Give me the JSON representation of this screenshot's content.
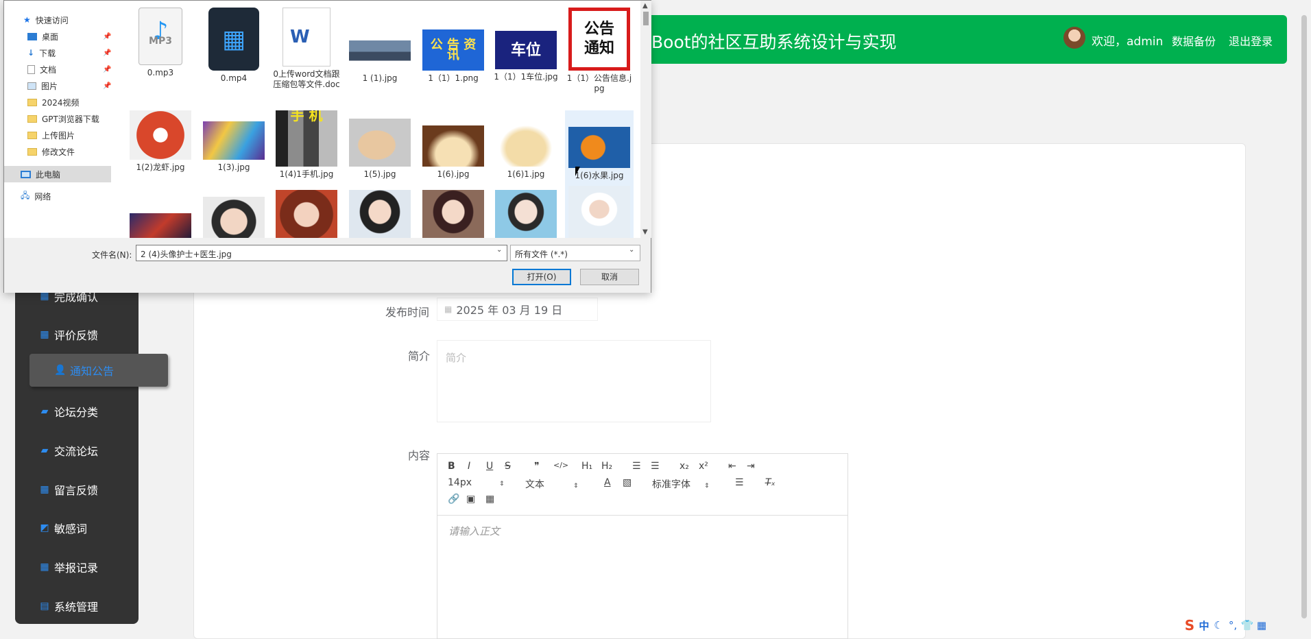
{
  "header": {
    "title": "Boot的社区互助系统设计与实现",
    "welcome": "欢迎，admin",
    "backup_label": "数据备份",
    "logout_label": "退出登录"
  },
  "sidebar": {
    "items": [
      {
        "label": "完成确认",
        "icon": "grid-icon"
      },
      {
        "label": "评价反馈",
        "icon": "grid-icon"
      },
      {
        "label": "通知公告",
        "icon": "user-icon",
        "active": true
      },
      {
        "label": "论坛分类",
        "icon": "chat-icon"
      },
      {
        "label": "交流论坛",
        "icon": "chat-icon"
      },
      {
        "label": "留言反馈",
        "icon": "grid-icon"
      },
      {
        "label": "敏感词",
        "icon": "chart-icon"
      },
      {
        "label": "举报记录",
        "icon": "grid-icon"
      },
      {
        "label": "系统管理",
        "icon": "clipboard-icon"
      }
    ]
  },
  "form": {
    "date_label": "发布时间",
    "date_value": "2025 年 03 月 19 日",
    "intro_label": "简介",
    "intro_placeholder": "简介",
    "content_label": "内容",
    "editor_placeholder": "请输入正文",
    "toolbar": {
      "font_size": "14px",
      "text_style": "文本",
      "font_family": "标准字体"
    }
  },
  "dialog": {
    "nav": [
      {
        "label": "快速访问",
        "icon": "star-icon"
      },
      {
        "label": "桌面",
        "icon": "desktop-icon",
        "pinned": true
      },
      {
        "label": "下载",
        "icon": "download-icon",
        "pinned": true
      },
      {
        "label": "文档",
        "icon": "document-icon",
        "pinned": true
      },
      {
        "label": "图片",
        "icon": "picture-icon",
        "pinned": true
      },
      {
        "label": "2024视频",
        "icon": "folder-icon"
      },
      {
        "label": "GPT浏览器下载",
        "icon": "folder-icon"
      },
      {
        "label": "上传图片",
        "icon": "folder-icon"
      },
      {
        "label": "修改文件",
        "icon": "folder-icon"
      },
      {
        "label": "此电脑",
        "icon": "computer-icon",
        "selected": true
      },
      {
        "label": "网络",
        "icon": "network-icon"
      }
    ],
    "files": [
      {
        "name": "0.mp3",
        "thumb_text": "MP3"
      },
      {
        "name": "0.mp4",
        "thumb_text": ""
      },
      {
        "name": "0上传word文档跟压缩包等文件.doc",
        "thumb_text": "W"
      },
      {
        "name": "1 (1).jpg",
        "thumb_text": ""
      },
      {
        "name": "1（1）1.png",
        "thumb_text": "公 告 资 讯"
      },
      {
        "name": "1（1）1车位.jpg",
        "thumb_text": "车位"
      },
      {
        "name": "1（1）公告信息.jpg",
        "thumb_text": "公告 通知"
      },
      {
        "name": "1(2)龙虾.jpg",
        "thumb_text": ""
      },
      {
        "name": "1(3).jpg",
        "thumb_text": ""
      },
      {
        "name": "1(4)1手机.jpg",
        "thumb_text": "手 机"
      },
      {
        "name": "1(5).jpg",
        "thumb_text": ""
      },
      {
        "name": "1(6).jpg",
        "thumb_text": ""
      },
      {
        "name": "1(6)1.jpg",
        "thumb_text": ""
      },
      {
        "name": "1(6)水果.jpg",
        "thumb_text": ""
      },
      {
        "name": "",
        "thumb_text": ""
      },
      {
        "name": "",
        "thumb_text": ""
      },
      {
        "name": "",
        "thumb_text": ""
      },
      {
        "name": "",
        "thumb_text": ""
      },
      {
        "name": "",
        "thumb_text": ""
      },
      {
        "name": "",
        "thumb_text": ""
      },
      {
        "name": "",
        "thumb_text": ""
      }
    ],
    "filename_label": "文件名(N):",
    "filename_value": "2 (4)头像护士+医生.jpg",
    "filetype_value": "所有文件 (*.*)",
    "open_label": "打开(O)",
    "cancel_label": "取消"
  },
  "ime": {
    "label": "中"
  },
  "colors": {
    "header_green": "#00b04f",
    "sidebar_bg": "#333333",
    "accent_blue": "#2d8cf0"
  }
}
